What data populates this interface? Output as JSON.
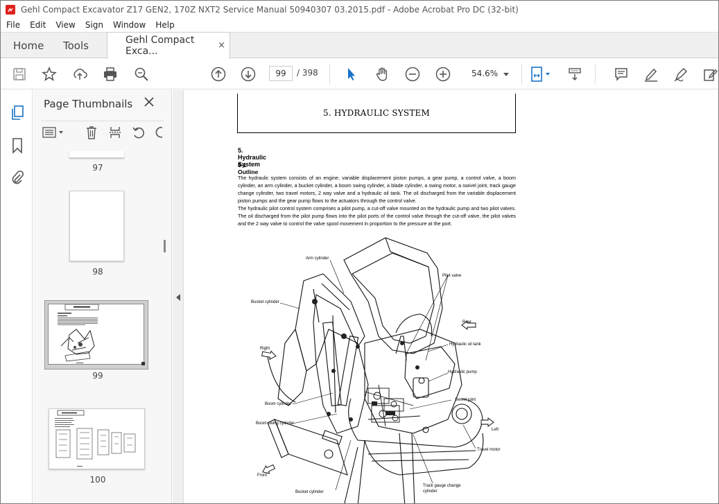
{
  "window": {
    "title": "Gehl Compact Excavator Z17 GEN2, 170Z NXT2 Service Manual 50940307 03.2015.pdf - Adobe Acrobat Pro DC (32-bit)"
  },
  "menu": [
    "File",
    "Edit",
    "View",
    "Sign",
    "Window",
    "Help"
  ],
  "tabs": {
    "home": "Home",
    "tools": "Tools",
    "document": "Gehl Compact Exca...",
    "close": "×"
  },
  "toolbar": {
    "current_page": "99",
    "page_total": "/  398",
    "zoom": "54.6%"
  },
  "thumbnails_panel": {
    "title": "Page Thumbnails",
    "pages": [
      "97",
      "98",
      "99",
      "100"
    ],
    "selected": "99"
  },
  "document": {
    "section_box_title": "5. HYDRAULIC SYSTEM",
    "heading": "5. Hydraulic System",
    "subheading": "5-1  Outline",
    "paragraph1": "The hydraulic system consists of an engine, variable displacement piston pumps, a gear pump, a control valve, a boom cylinder, an arm cylinder, a bucket cylinder, a boom swing cylinder, a blade cylinder, a swing motor, a swivel joint, track gauge change cylinder, two travel motors, 2 way valve and a hydraulic oil tank. The oil discharged from the variable displacement piston pumps and the gear pump flows to the actuators through the control valve.",
    "paragraph2": "The hydraulic pilot control system comprises a pilot pump, a cut-off valve mounted on the hydraulic pump and two pilot valves. The oil discharged from the pilot pump flows into the pilot ports of the control valve through the cut-off valve, the pilot valves and the 2 way valve to control the valve spool movement in proportion to the pressure at the port.",
    "figure_labels": {
      "arm_cylinder": "Arm cylinder",
      "pilot_valve": "Pilot valve",
      "bucket_cylinder_top": "Bucket cylinder",
      "rear": "Rear",
      "right": "Right",
      "hydraulic_oil_tank": "Hydraulic oil tank",
      "hydraulic_pump": "Hydraulic pump",
      "swivel_joint": "Swivel joint",
      "boom_cylinder": "Boom cylinder",
      "boom_swing_cylinder": "Boom swing cylinder",
      "left": "Left",
      "travel_motor": "Travel motor",
      "front": "Front",
      "track_gauge": "Track gauge change\ncylinder",
      "bucket_cylinder_bottom": "Bucket cylinder"
    }
  },
  "colors": {
    "accent": "#1a73c8",
    "pdf_red": "#e0211b",
    "selected_thumb": "#cfcfcf"
  }
}
